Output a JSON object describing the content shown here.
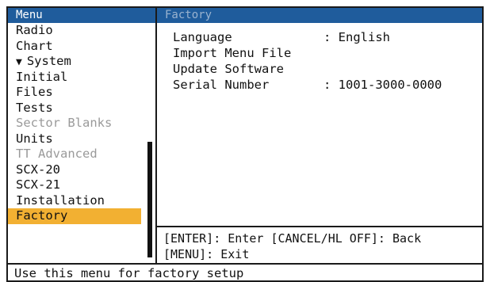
{
  "menu": {
    "title": "Menu",
    "items": [
      {
        "label": "Radio",
        "state": "normal"
      },
      {
        "label": "Chart",
        "state": "normal"
      },
      {
        "label": "System",
        "state": "expanded",
        "icon": "down-triangle-icon"
      },
      {
        "label": "Initial",
        "state": "normal"
      },
      {
        "label": "Files",
        "state": "normal"
      },
      {
        "label": "Tests",
        "state": "normal"
      },
      {
        "label": "Sector Blanks",
        "state": "disabled"
      },
      {
        "label": "Units",
        "state": "normal"
      },
      {
        "label": "TT Advanced",
        "state": "disabled"
      },
      {
        "label": "SCX-20",
        "state": "normal"
      },
      {
        "label": "SCX-21",
        "state": "normal"
      },
      {
        "label": "Installation",
        "state": "normal"
      },
      {
        "label": "Factory",
        "state": "selected"
      }
    ],
    "arrow_glyph": "▼"
  },
  "detail": {
    "title": "Factory",
    "settings": [
      {
        "label": "Language",
        "value": ": English"
      },
      {
        "label": "Import Menu File",
        "value": ""
      },
      {
        "label": "Update Software",
        "value": ""
      },
      {
        "label": "Serial Number",
        "value": ": 1001-3000-0000"
      }
    ],
    "help_line1": "[ENTER]: Enter [CANCEL/HL OFF]: Back",
    "help_line2": "[MENU]: Exit"
  },
  "status": {
    "text": "Use this menu for factory setup"
  },
  "colors": {
    "title_bar": "#1f5c9c",
    "selected_highlight": "#f2b032",
    "disabled_text": "#9a9a9a"
  }
}
